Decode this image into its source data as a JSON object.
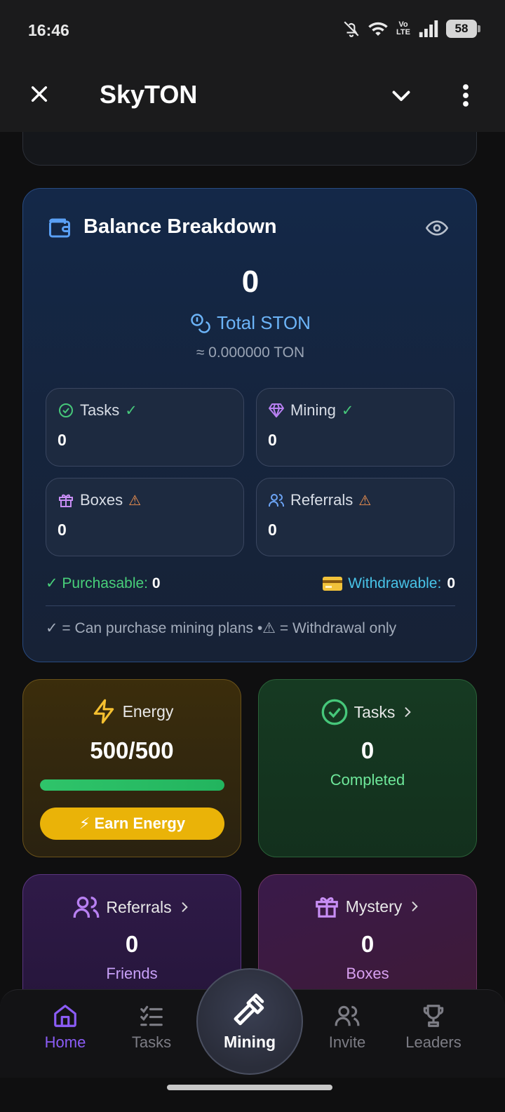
{
  "status_bar": {
    "time": "16:46",
    "network": "Vo LTE",
    "battery": "58"
  },
  "header": {
    "title": "SkyTON"
  },
  "balance": {
    "title": "Balance Breakdown",
    "total_value": "0",
    "total_label": "Total STON",
    "ton_equivalent": "≈ 0.000000 TON",
    "sources": [
      {
        "label": "Tasks",
        "mark": "✓",
        "value": "0"
      },
      {
        "label": "Mining",
        "mark": "✓",
        "value": "0"
      },
      {
        "label": "Boxes",
        "mark": "⚠",
        "value": "0"
      },
      {
        "label": "Referrals",
        "mark": "⚠",
        "value": "0"
      }
    ],
    "purchasable_label": "✓ Purchasable:",
    "purchasable_value": "0",
    "withdrawable_label": "Withdrawable:",
    "withdrawable_value": "0",
    "legend": "✓ = Can purchase mining plans •⚠ = Withdrawal only"
  },
  "energy": {
    "label": "Energy",
    "value": "500/500",
    "fill_fraction": 1.0,
    "button": "⚡ Earn Energy"
  },
  "tasks": {
    "label": "Tasks",
    "value": "0",
    "sub": "Completed"
  },
  "referrals": {
    "label": "Referrals",
    "value": "0",
    "sub": "Friends"
  },
  "mystery": {
    "label": "Mystery",
    "value": "0",
    "sub": "Boxes"
  },
  "nav": {
    "home": "Home",
    "tasks": "Tasks",
    "mining": "Mining",
    "invite": "Invite",
    "leaders": "Leaders"
  },
  "colors": {
    "accent": "#8b5cf6",
    "energy_yellow": "#eab308",
    "success_green": "#48d07a",
    "info_blue": "#6cb4f8"
  }
}
